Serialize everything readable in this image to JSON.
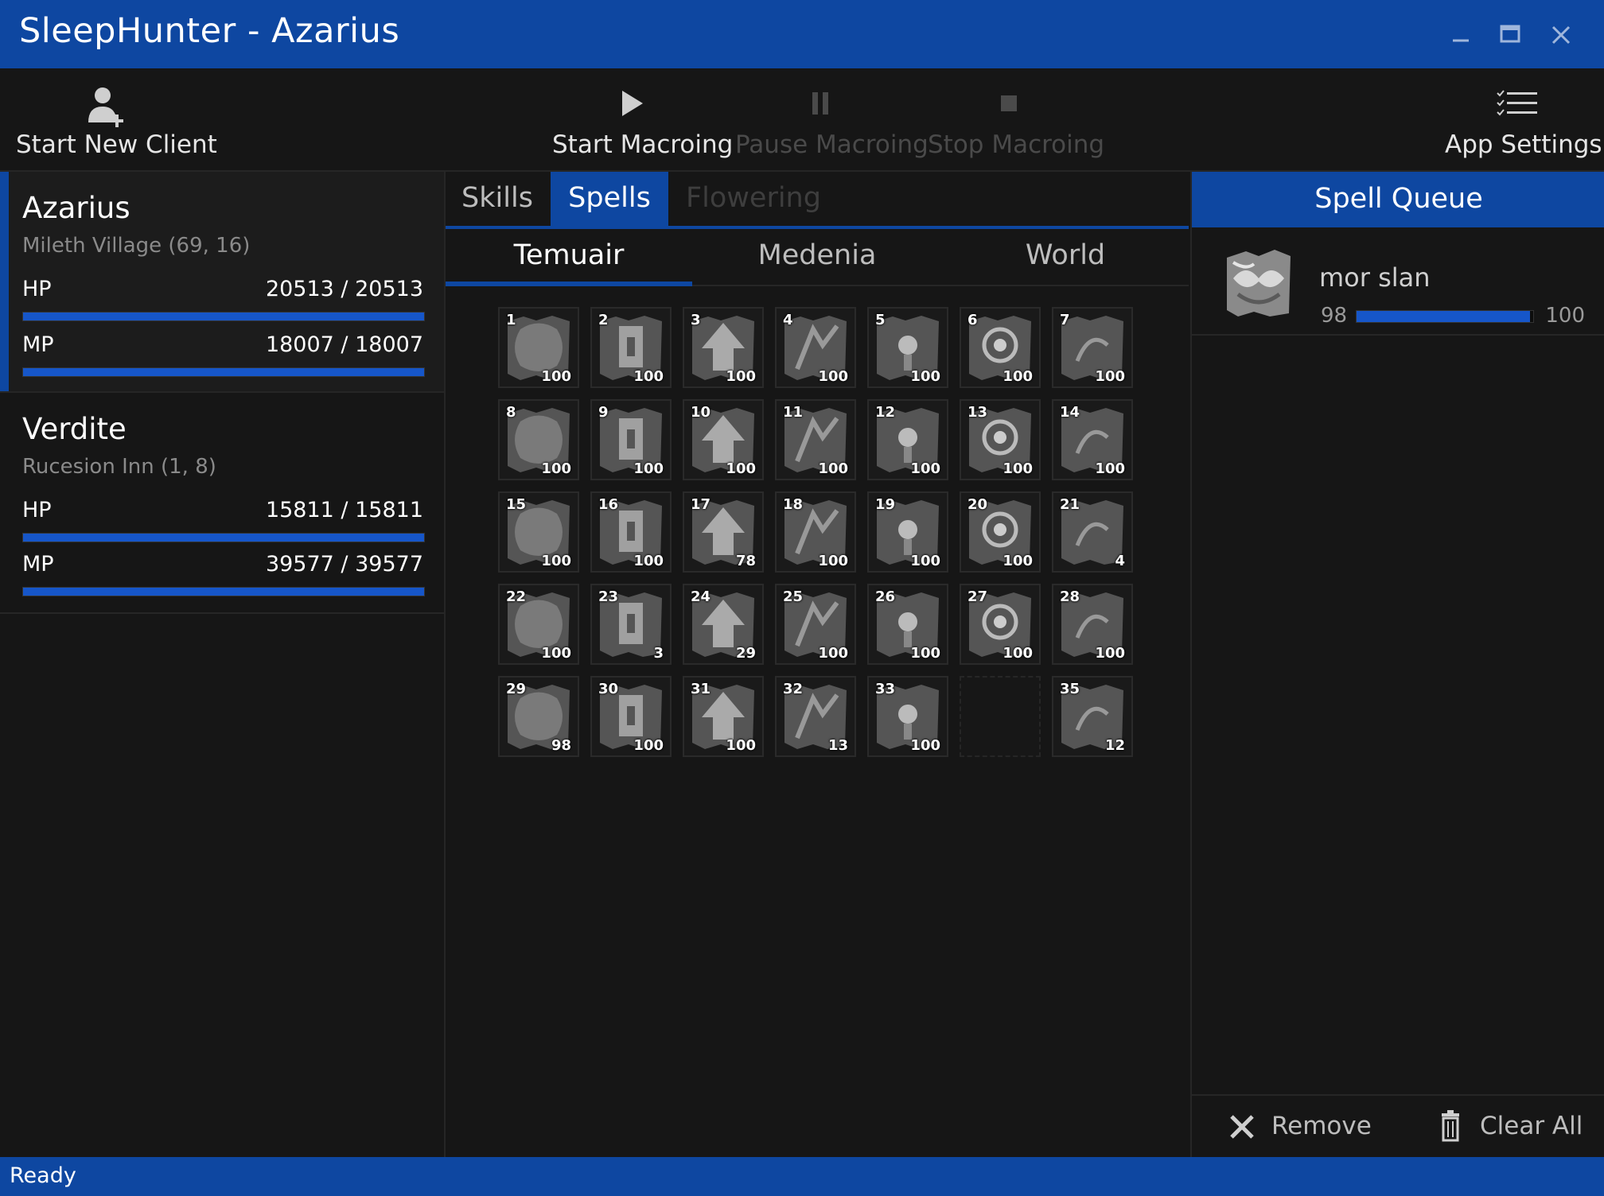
{
  "window": {
    "title": "SleepHunter - Azarius"
  },
  "toolbar": {
    "start_new_client": "Start New Client",
    "start_macroing": "Start Macroing",
    "pause_macroing": "Pause Macroing",
    "stop_macroing": "Stop Macroing",
    "app_settings": "App Settings"
  },
  "clients": [
    {
      "name": "Azarius",
      "location": "Mileth Village (69, 16)",
      "hp_label": "HP",
      "hp": "20513 / 20513",
      "hp_fraction": 1.0,
      "mp_label": "MP",
      "mp": "18007 / 18007",
      "mp_fraction": 1.0,
      "selected": true
    },
    {
      "name": "Verdite",
      "location": "Rucesion Inn (1, 8)",
      "hp_label": "HP",
      "hp": "15811 / 15811",
      "hp_fraction": 1.0,
      "mp_label": "MP",
      "mp": "39577 / 39577",
      "mp_fraction": 1.0,
      "selected": false
    }
  ],
  "tabs": {
    "skills": "Skills",
    "spells": "Spells",
    "flowering": "Flowering"
  },
  "subtabs": {
    "temuair": "Temuair",
    "medenia": "Medenia",
    "world": "World"
  },
  "spell_slots": [
    {
      "num": "1",
      "level": "100"
    },
    {
      "num": "2",
      "level": "100"
    },
    {
      "num": "3",
      "level": "100"
    },
    {
      "num": "4",
      "level": "100"
    },
    {
      "num": "5",
      "level": "100"
    },
    {
      "num": "6",
      "level": "100"
    },
    {
      "num": "7",
      "level": "100"
    },
    {
      "num": "8",
      "level": "100"
    },
    {
      "num": "9",
      "level": "100"
    },
    {
      "num": "10",
      "level": "100"
    },
    {
      "num": "11",
      "level": "100"
    },
    {
      "num": "12",
      "level": "100"
    },
    {
      "num": "13",
      "level": "100"
    },
    {
      "num": "14",
      "level": "100"
    },
    {
      "num": "15",
      "level": "100"
    },
    {
      "num": "16",
      "level": "100"
    },
    {
      "num": "17",
      "level": "78"
    },
    {
      "num": "18",
      "level": "100"
    },
    {
      "num": "19",
      "level": "100"
    },
    {
      "num": "20",
      "level": "100"
    },
    {
      "num": "21",
      "level": "4"
    },
    {
      "num": "22",
      "level": "100"
    },
    {
      "num": "23",
      "level": "3"
    },
    {
      "num": "24",
      "level": "29"
    },
    {
      "num": "25",
      "level": "100"
    },
    {
      "num": "26",
      "level": "100"
    },
    {
      "num": "27",
      "level": "100"
    },
    {
      "num": "28",
      "level": "100"
    },
    {
      "num": "29",
      "level": "98"
    },
    {
      "num": "30",
      "level": "100"
    },
    {
      "num": "31",
      "level": "100"
    },
    {
      "num": "32",
      "level": "13"
    },
    {
      "num": "33",
      "level": "100"
    },
    {
      "num": "",
      "level": "",
      "empty": true
    },
    {
      "num": "35",
      "level": "12"
    }
  ],
  "spell_queue": {
    "header": "Spell Queue",
    "items": [
      {
        "name": "mor slan",
        "current": "98",
        "max": "100",
        "fraction": 0.98
      }
    ],
    "remove_label": "Remove",
    "clear_all_label": "Clear All"
  },
  "status": {
    "text": "Ready"
  },
  "colors": {
    "accent": "#0e47a1",
    "bar_fill": "#1656c9",
    "background": "#161616"
  }
}
